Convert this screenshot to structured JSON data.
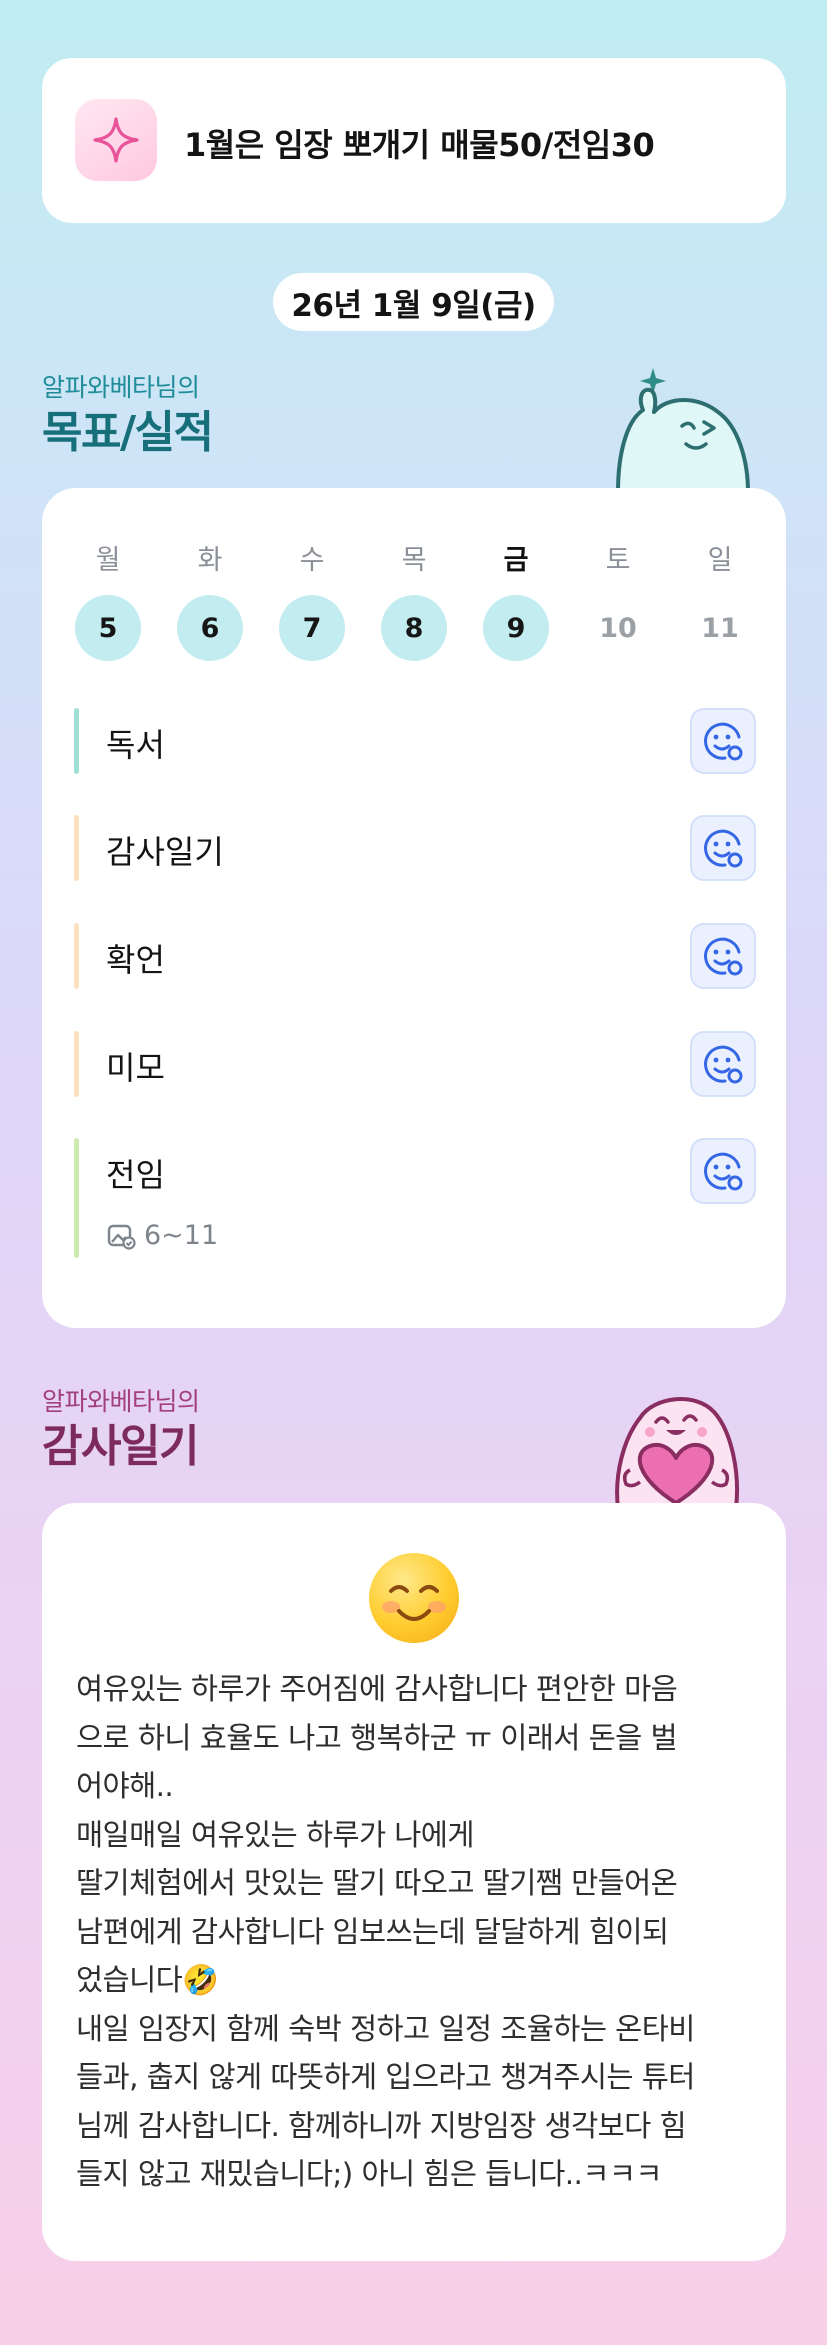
{
  "goal_banner": {
    "text": "1월은 임장 뽀개기 매물50/전임30",
    "icon": "sparkle-icon"
  },
  "date": "26년 1월 9일(금)",
  "goals_section": {
    "owner": "알파와베타님의",
    "title": "목표/실적"
  },
  "week": {
    "days": [
      {
        "label": "월",
        "num": "5",
        "state": "done"
      },
      {
        "label": "화",
        "num": "6",
        "state": "done"
      },
      {
        "label": "수",
        "num": "7",
        "state": "done"
      },
      {
        "label": "목",
        "num": "8",
        "state": "done"
      },
      {
        "label": "금",
        "num": "9",
        "state": "today"
      },
      {
        "label": "토",
        "num": "10",
        "state": "future"
      },
      {
        "label": "일",
        "num": "11",
        "state": "future"
      }
    ]
  },
  "tasks": [
    {
      "name": "독서",
      "bar_color": "#9fe0d6",
      "icon": "smile-add-icon"
    },
    {
      "name": "감사일기",
      "bar_color": "#fde0bd",
      "icon": "smile-add-icon"
    },
    {
      "name": "확언",
      "bar_color": "#fde0bd",
      "icon": "smile-add-icon"
    },
    {
      "name": "미모",
      "bar_color": "#fde0bd",
      "icon": "smile-add-icon"
    },
    {
      "name": "전임",
      "bar_color": "#cdebb0",
      "icon": "smile-add-icon",
      "meta": "6~11",
      "meta_icon": "image-check-icon"
    }
  ],
  "gratitude_section": {
    "owner": "알파와베타님의",
    "title": "감사일기"
  },
  "gratitude": {
    "mood_icon": "smiling-face-emoji",
    "text": "여유있는 하루가 주어짐에 감사합니다 편안한 마음\n으로 하니 효율도 나고 행복하군 ㅠ 이래서 돈을 벌\n어야해..\n매일매일 여유있는 하루가 나에게\n딸기체험에서 맛있는 딸기 따오고 딸기쨈 만들어온\n남편에게 감사합니다 임보쓰는데 달달하게 힘이되\n었습니다🤣\n내일 임장지 함께 숙박 정하고 일정 조율하는 온타비\n들과, 춥지 않게 따뜻하게 입으라고 챙겨주시는 튜터\n님께 감사합니다. 함께하니까 지방임장 생각보다 힘\n들지 않고 재밌습니다;) 아니 힘은 듭니다..ㅋㅋㅋ"
  },
  "colors": {
    "accent_teal": "#176f7a",
    "accent_plum": "#7d2a5c",
    "day_done": "#c2ecef",
    "button_blue": "#3466e6"
  }
}
